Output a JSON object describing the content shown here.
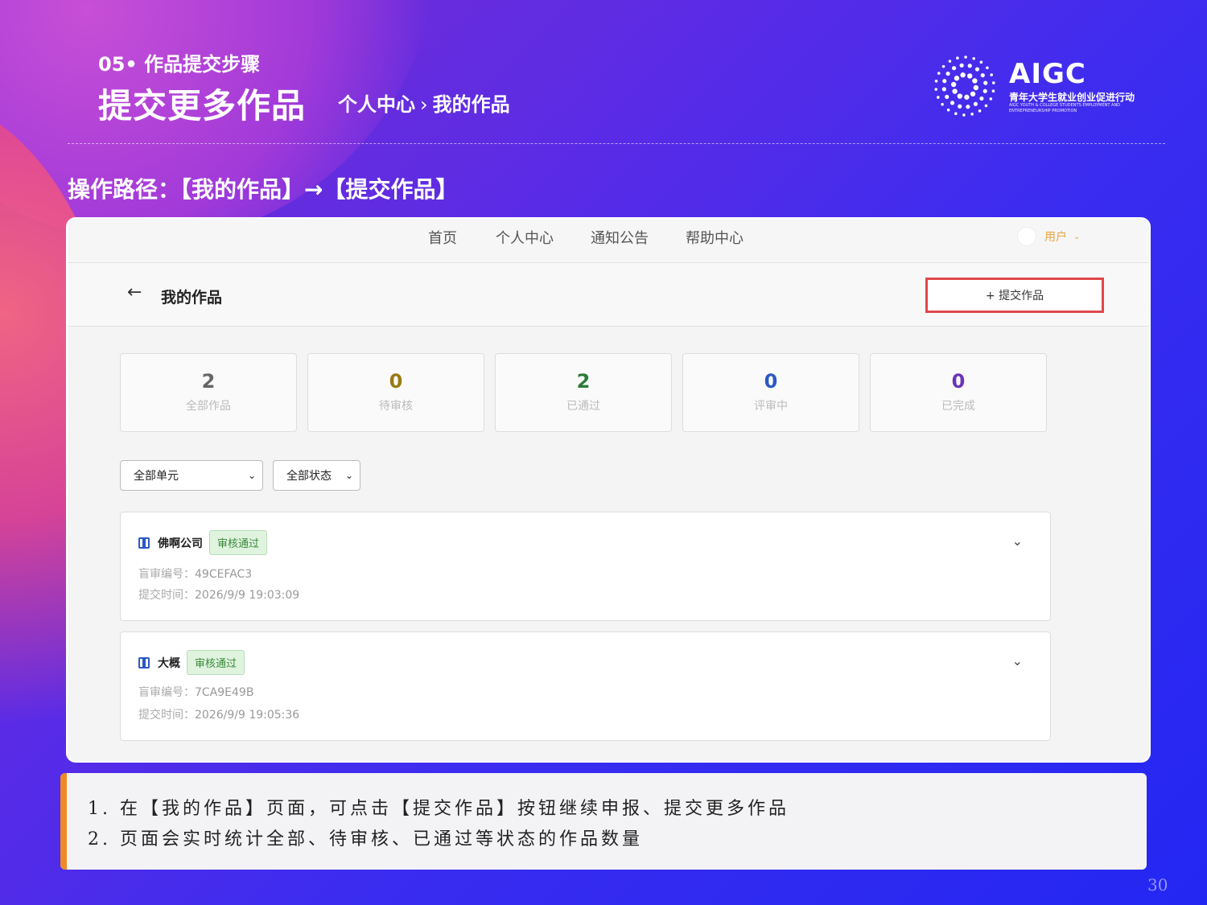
{
  "header": {
    "kicker": "05• 作品提交步骤",
    "title": "提交更多作品",
    "breadcrumb": [
      "个人中心",
      "我的作品"
    ],
    "breadcrumb_sep": "›",
    "logo": {
      "name": "AIGC",
      "subtitle": "青年大学生就业创业促进行动",
      "english": "AIGC YOUTH & COLLEGE STUDENTS EMPLOYMENT AND ENTREPRENEURSHIP PROMOTION"
    }
  },
  "path_text": "操作路径：【我的作品】→【提交作品】",
  "screenshot": {
    "nav": {
      "items": [
        "首页",
        "个人中心",
        "通知公告",
        "帮助中心"
      ],
      "user_label": "用户",
      "user_chevron": "⌄"
    },
    "subhead": {
      "back_glyph": "←",
      "title": "我的作品",
      "submit_label": "+ 提交作品"
    },
    "stats": [
      {
        "value": "2",
        "label": "全部作品",
        "color": "#666666"
      },
      {
        "value": "0",
        "label": "待审核",
        "color": "#9a7a10"
      },
      {
        "value": "2",
        "label": "已通过",
        "color": "#2d7a3a"
      },
      {
        "value": "0",
        "label": "评审中",
        "color": "#2b59c3"
      },
      {
        "value": "0",
        "label": "已完成",
        "color": "#6a35b8"
      }
    ],
    "filters": {
      "unit": "全部单元",
      "status": "全部状态",
      "caret": "⌄"
    },
    "works": [
      {
        "name": "佛啊公司",
        "status": "审核通过",
        "code_label": "盲审编号：",
        "code": "49CEFAC3",
        "time_label": "提交时间：",
        "time": "2026/9/9 19:03:09"
      },
      {
        "name": "大概",
        "status": "审核通过",
        "code_label": "盲审编号：",
        "code": "7CA9E49B",
        "time_label": "提交时间：",
        "time": "2026/9/9 19:05:36"
      }
    ],
    "expand_glyph": "⌄"
  },
  "notes": [
    "1.  在【我的作品】页面，可点击【提交作品】按钮继续申报、提交更多作品",
    "2.  页面会实时统计全部、待审核、已通过等状态的作品数量"
  ],
  "page_number": "30",
  "colors": {
    "accent_red": "#e0474a",
    "accent_orange": "#f08a24"
  }
}
